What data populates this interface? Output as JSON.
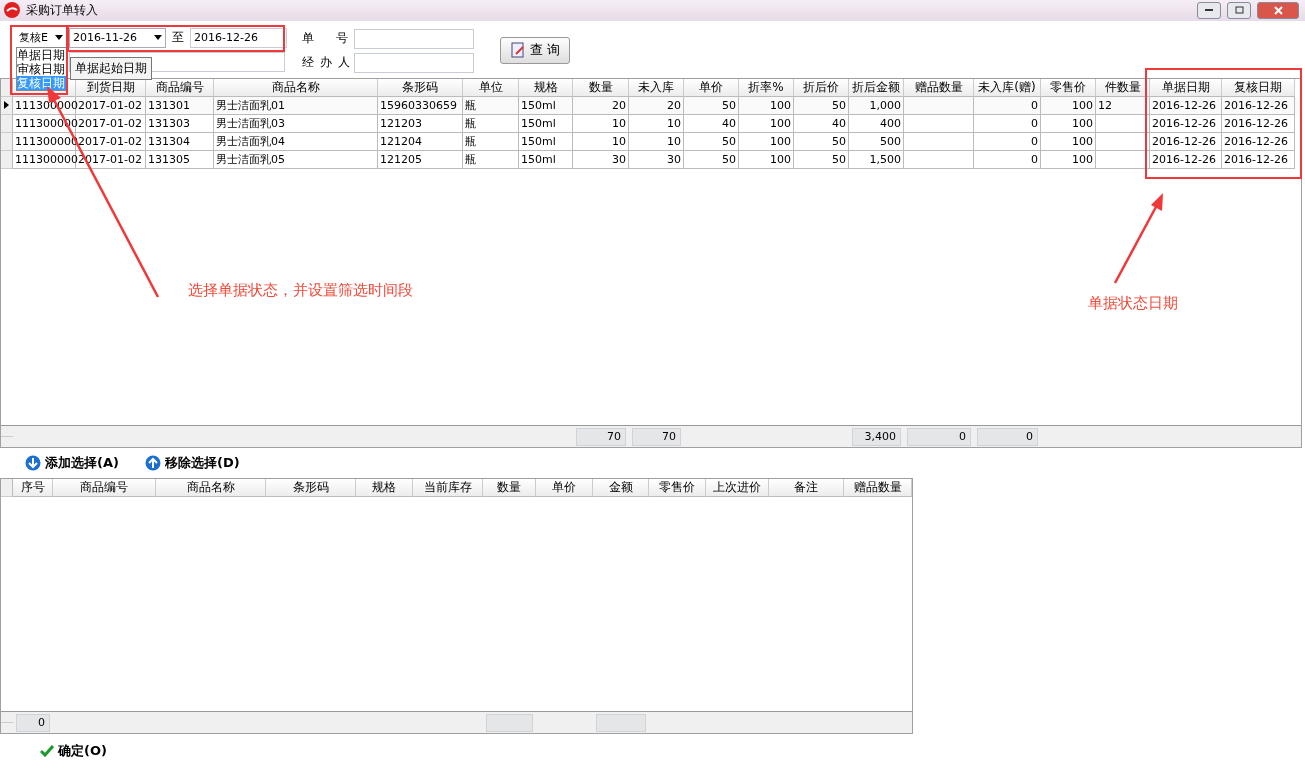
{
  "window": {
    "title": "采购订单转入"
  },
  "filter": {
    "date_type": {
      "value": "复核E",
      "options": [
        {
          "label": "单据日期",
          "selected": false
        },
        {
          "label": "审核日期",
          "selected": false
        },
        {
          "label": "复核日期",
          "selected": true
        }
      ]
    },
    "date_from": "2016-11-26",
    "to_label": "至",
    "date_to": "2016-12-26",
    "tooltip": "单据起始日期",
    "order_no_label": "单 号",
    "handler_label": "经 办 人",
    "query_button": "查 询"
  },
  "upper_table": {
    "columns": [
      {},
      {
        "label": "到货日期"
      },
      {
        "label": "商品编号"
      },
      {
        "label": "商品名称"
      },
      {
        "label": "条形码"
      },
      {
        "label": "单位"
      },
      {
        "label": "规格"
      },
      {
        "label": "数量"
      },
      {
        "label": "未入库"
      },
      {
        "label": "单价"
      },
      {
        "label": "折率%"
      },
      {
        "label": "折后价"
      },
      {
        "label": "折后金额"
      },
      {
        "label": "赠品数量"
      },
      {
        "label": "未入库(赠)"
      },
      {
        "label": "零售价"
      },
      {
        "label": "件数量"
      },
      {
        "label": "单据日期"
      },
      {
        "label": "复核日期"
      }
    ],
    "rows": [
      {
        "current": true,
        "cells": [
          "111300000",
          "2017-01-02",
          "131301",
          "男士洁面乳01",
          "15960330659",
          "瓶",
          "150ml",
          "20",
          "20",
          "50",
          "100",
          "50",
          "1,000",
          null,
          "0",
          "100",
          "12",
          "2016-12-26",
          "2016-12-26"
        ]
      },
      {
        "current": false,
        "cells": [
          "111300000",
          "2017-01-02",
          "131303",
          "男士洁面乳03",
          "121203",
          "瓶",
          "150ml",
          "10",
          "10",
          "40",
          "100",
          "40",
          "400",
          null,
          "0",
          "100",
          null,
          "2016-12-26",
          "2016-12-26"
        ]
      },
      {
        "current": false,
        "cells": [
          "111300000",
          "2017-01-02",
          "131304",
          "男士洁面乳04",
          "121204",
          "瓶",
          "150ml",
          "10",
          "10",
          "50",
          "100",
          "50",
          "500",
          null,
          "0",
          "100",
          null,
          "2016-12-26",
          "2016-12-26"
        ]
      },
      {
        "current": false,
        "cells": [
          "111300000",
          "2017-01-02",
          "131305",
          "男士洁面乳05",
          "121205",
          "瓶",
          "150ml",
          "30",
          "30",
          "50",
          "100",
          "50",
          "1,500",
          null,
          "0",
          "100",
          null,
          "2016-12-26",
          "2016-12-26"
        ]
      }
    ],
    "totals": [
      {
        "kind": "blank"
      },
      {
        "kind": "blank"
      },
      {
        "kind": "blank"
      },
      {
        "kind": "blank"
      },
      {
        "kind": "blank"
      },
      {
        "kind": "blank"
      },
      {
        "kind": "blank"
      },
      {
        "kind": "value",
        "text": "70"
      },
      {
        "kind": "value",
        "text": "70"
      },
      {
        "kind": "blank"
      },
      {
        "kind": "blank"
      },
      {
        "kind": "blank"
      },
      {
        "kind": "value",
        "text": "3,400"
      },
      {
        "kind": "value",
        "text": "0"
      },
      {
        "kind": "value",
        "text": "0"
      },
      {
        "kind": "blank"
      },
      {
        "kind": "blank"
      },
      {
        "kind": "blank"
      },
      {
        "kind": "blank"
      }
    ]
  },
  "actions": [
    {
      "label": "添加选择(A)",
      "kind": "down"
    },
    {
      "label": "移除选择(D)",
      "kind": "up"
    }
  ],
  "lower_table": {
    "columns": [
      {
        "label": "序号"
      },
      {
        "label": "商品编号"
      },
      {
        "label": "商品名称"
      },
      {
        "label": "条形码"
      },
      {
        "label": "规格"
      },
      {
        "label": "当前库存"
      },
      {
        "label": "数量"
      },
      {
        "label": "单价"
      },
      {
        "label": "金额"
      },
      {
        "label": "零售价"
      },
      {
        "label": "上次进价"
      },
      {
        "label": "备注"
      },
      {
        "label": "赠品数量"
      }
    ],
    "totals": [
      {
        "kind": "value",
        "text": "0"
      },
      {
        "kind": "blank"
      },
      {
        "kind": "blank"
      },
      {
        "kind": "blank"
      },
      {
        "kind": "blank"
      },
      {
        "kind": "blank"
      },
      {
        "kind": "box"
      },
      {
        "kind": "blank"
      },
      {
        "kind": "box"
      },
      {
        "kind": "blank"
      },
      {
        "kind": "blank"
      },
      {
        "kind": "blank"
      },
      {
        "kind": "blank"
      }
    ]
  },
  "confirm_button": "确定(O)",
  "annotations": [
    {
      "text": "选择单据状态，并设置筛选时间段"
    },
    {
      "text": "单据状态日期"
    }
  ]
}
